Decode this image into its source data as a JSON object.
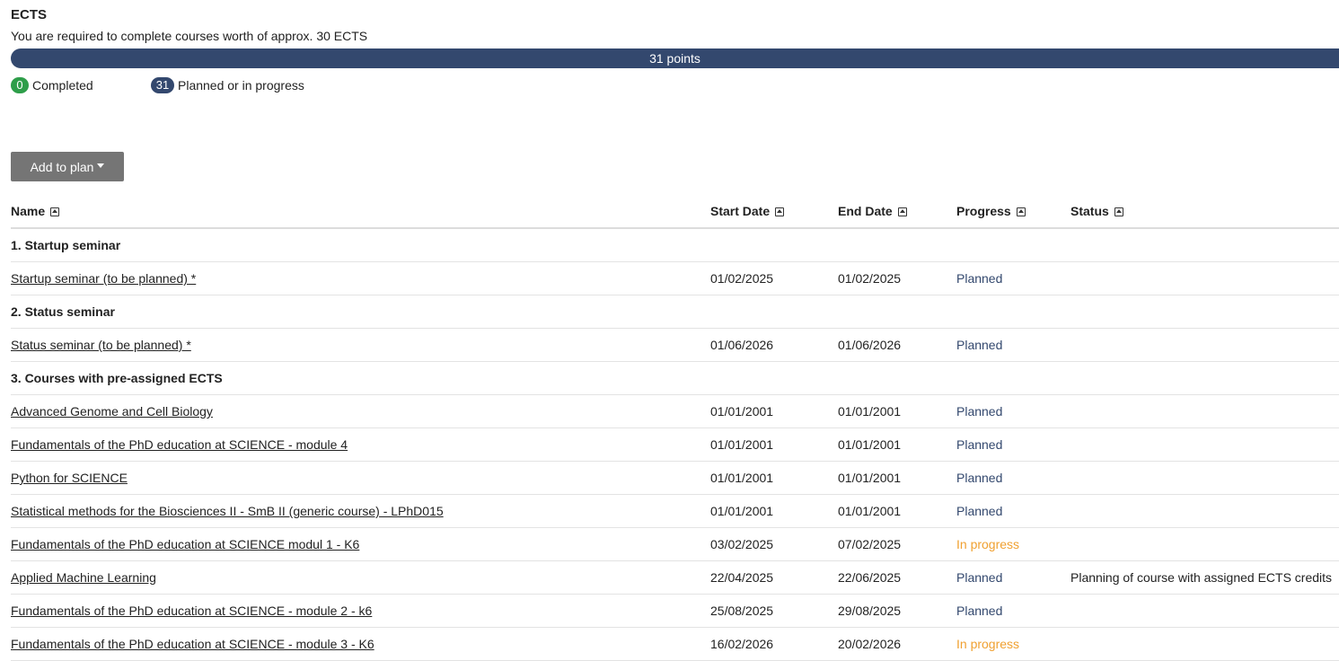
{
  "ects": {
    "title": "ECTS",
    "subtitle": "You are required to complete courses worth of approx. 30 ECTS",
    "progress_label": "31 points",
    "completed_count": "0",
    "completed_label": "Completed",
    "planned_count": "31",
    "planned_label": "Planned or in progress",
    "progress_fraction": 1.0
  },
  "toolbar": {
    "add_label": "Add to plan"
  },
  "table": {
    "headers": [
      "Name",
      "Start Date",
      "End Date",
      "Progress",
      "Status"
    ],
    "groups": [
      {
        "title": "1. Startup seminar",
        "rows": [
          {
            "name": "Startup seminar (to be planned) *",
            "start": "01/02/2025",
            "end": "01/02/2025",
            "progress": "Planned",
            "state": "planned",
            "status": ""
          }
        ]
      },
      {
        "title": "2. Status seminar",
        "rows": [
          {
            "name": "Status seminar (to be planned) *",
            "start": "01/06/2026",
            "end": "01/06/2026",
            "progress": "Planned",
            "state": "planned",
            "status": ""
          }
        ]
      },
      {
        "title": "3. Courses with pre-assigned ECTS",
        "rows": [
          {
            "name": "Advanced Genome and Cell Biology",
            "start": "01/01/2001",
            "end": "01/01/2001",
            "progress": "Planned",
            "state": "planned",
            "status": ""
          },
          {
            "name": "Fundamentals of the PhD education at SCIENCE - module 4",
            "start": "01/01/2001",
            "end": "01/01/2001",
            "progress": "Planned",
            "state": "planned",
            "status": ""
          },
          {
            "name": "Python for SCIENCE",
            "start": "01/01/2001",
            "end": "01/01/2001",
            "progress": "Planned",
            "state": "planned",
            "status": ""
          },
          {
            "name": "Statistical methods for the Biosciences II - SmB II (generic course) - LPhD015",
            "start": "01/01/2001",
            "end": "01/01/2001",
            "progress": "Planned",
            "state": "planned",
            "status": ""
          },
          {
            "name": "Fundamentals of the PhD education at SCIENCE modul 1 - K6",
            "start": "03/02/2025",
            "end": "07/02/2025",
            "progress": "In progress",
            "state": "inprogress",
            "status": ""
          },
          {
            "name": "Applied Machine Learning",
            "start": "22/04/2025",
            "end": "22/06/2025",
            "progress": "Planned",
            "state": "planned",
            "status": "Planning of course with assigned ECTS credits"
          },
          {
            "name": "Fundamentals of the PhD education at SCIENCE - module 2 - k6",
            "start": "25/08/2025",
            "end": "29/08/2025",
            "progress": "Planned",
            "state": "planned",
            "status": ""
          },
          {
            "name": "Fundamentals of the PhD education at SCIENCE - module 3 - K6",
            "start": "16/02/2026",
            "end": "20/02/2026",
            "progress": "In progress",
            "state": "inprogress",
            "status": ""
          }
        ]
      }
    ]
  },
  "colors": {
    "navy": "#33486e",
    "green": "#2e9e4a",
    "in_progress": "#f0a030",
    "button": "#757575"
  },
  "icons": {
    "sort": "sort-toggle-icon",
    "dropdown": "caret-down-icon"
  }
}
